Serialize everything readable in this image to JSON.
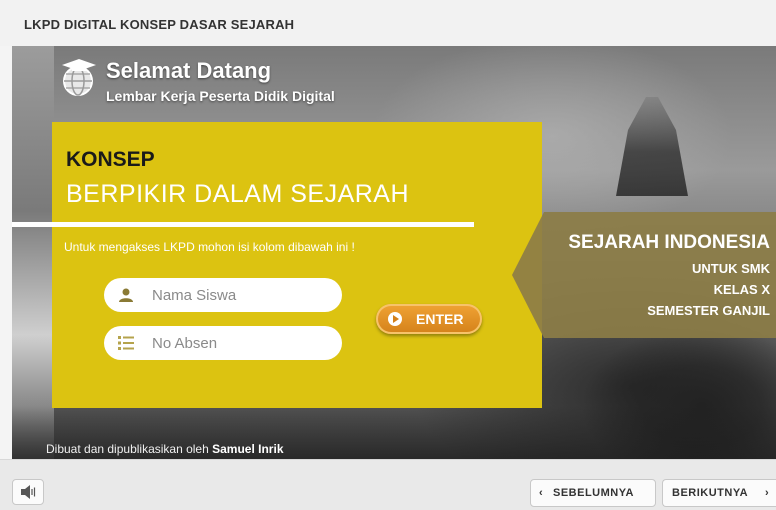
{
  "app": {
    "title": "LKPD DIGITAL KONSEP DASAR SEJARAH"
  },
  "welcome": {
    "title": "Selamat Datang",
    "subtitle": "Lembar Kerja Peserta Didik Digital"
  },
  "form": {
    "heading_1": "KONSEP",
    "heading_2": "BERPIKIR DALAM SEJARAH",
    "instruction": "Untuk mengakses LKPD mohon isi kolom dibawah ini !",
    "name_placeholder": "Nama Siswa",
    "name_value": "",
    "absen_placeholder": "No Absen",
    "absen_value": "",
    "enter_label": "ENTER"
  },
  "info": {
    "title": "SEJARAH INDONESIA",
    "line_1": "UNTUK SMK",
    "line_2": "KELAS X",
    "line_3": "SEMESTER GANJIL"
  },
  "credit": {
    "prefix": "Dibuat dan dipublikasikan oleh",
    "author": "Samuel Inrik"
  },
  "toolbar": {
    "prev_label": "SEBELUMNYA",
    "next_label": "BERIKUTNYA",
    "prev_icon": "‹",
    "next_icon": "›"
  },
  "colors": {
    "panel_yellow": "#dcc311",
    "enter_orange": "#e6962a",
    "info_panel": "#8c7d46"
  }
}
